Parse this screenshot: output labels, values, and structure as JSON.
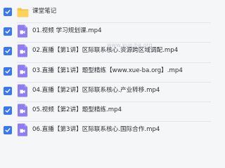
{
  "items": [
    {
      "type": "folder",
      "name": "课堂笔记"
    },
    {
      "type": "video",
      "name": "01.视频 学习规划课.mp4"
    },
    {
      "type": "video",
      "name": "02.直播【第1讲】区际联系核心.资源跨区域调配.mp4"
    },
    {
      "type": "video",
      "name": "03.直播【第1讲】题型精练【www.xue-ba.org】.mp4"
    },
    {
      "type": "video",
      "name": "04.直播【第2讲】区际联系核心.产业转移.mp4"
    },
    {
      "type": "video",
      "name": "05.视频【第2讲】题型精练.mp4"
    },
    {
      "type": "video",
      "name": "06.直播【第3讲】区际联系核心.国际合作.mp4"
    }
  ],
  "watermark": "www.xue-ba.org",
  "colors": {
    "check": "#3b77f2",
    "folder": "#f7c445",
    "video_icon": "#8e7cf0",
    "background": "#f5f6f8"
  }
}
